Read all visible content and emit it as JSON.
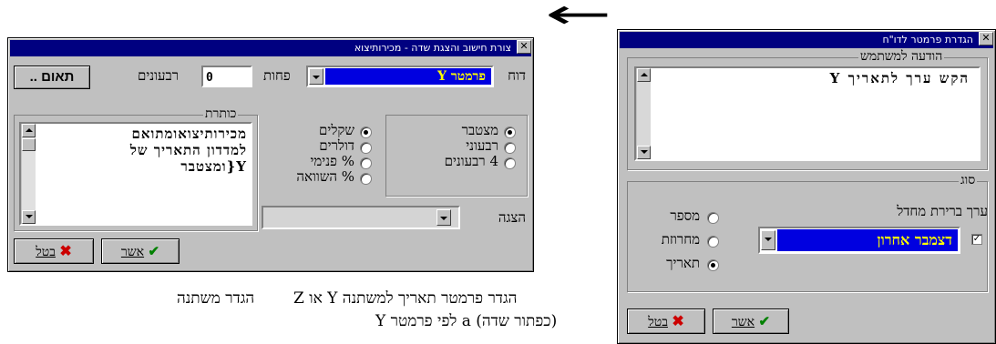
{
  "arrow": {
    "glyph": "←"
  },
  "left_dialog": {
    "title": "צורת חישוב והצגת שדה - מכירותיצוא",
    "dooh_label": "דוח",
    "parameter_value": "פרמטר Y",
    "pachot_label": "פחות",
    "quarters_value": "0",
    "quarters_label": "רבעונים",
    "taoom_button": "תאום ..",
    "calc_options": [
      {
        "label": "מצטבר",
        "selected": true
      },
      {
        "label": "רבעוני",
        "selected": false
      },
      {
        "label": "4 רבעונים",
        "selected": false
      }
    ],
    "unit_options": [
      {
        "label": "שקלים",
        "selected": true
      },
      {
        "label": "דולרים",
        "selected": false
      },
      {
        "label": "% פנימי",
        "selected": false
      },
      {
        "label": "% השוואה",
        "selected": false
      }
    ],
    "heading_group_label": "כותרת",
    "heading_lines": [
      "מכירותיצואומתואם",
      "למדדון התאריך של",
      "Y{ומצטבר"
    ],
    "display_label": "הצגה",
    "ok_button": "אשר",
    "cancel_button": "בטל"
  },
  "right_dialog": {
    "title": "הגדרת פרמטר לדו\"ח",
    "message_group_label": "הודעה למשתמש",
    "message_text": "הקש ערך לתאריך Y",
    "type_group_label": "סוג",
    "default_label": "ערך ברירת מחדל",
    "default_value": "דצמבר אחרון",
    "default_checked": true,
    "type_options": [
      {
        "label": "מספר",
        "selected": false
      },
      {
        "label": "מחרוזת",
        "selected": false
      },
      {
        "label": "תאריך",
        "selected": true
      }
    ],
    "ok_button": "אשר",
    "cancel_button": "בטל"
  },
  "captions": {
    "left": "הגדר משתנה",
    "middle_line1": "הגדר פרמטר תאריך למשתנה Y או Z",
    "middle_line2": "(כפתור שדה)  a לפי פרמטר Y"
  }
}
